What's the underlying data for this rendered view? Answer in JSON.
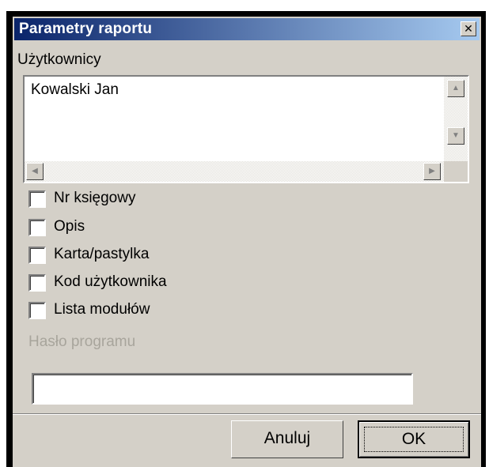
{
  "window": {
    "title": "Parametry raportu",
    "close_glyph": "✕"
  },
  "users": {
    "label": "Użytkownicy",
    "items": [
      "Kowalski  Jan"
    ]
  },
  "options": [
    {
      "label": "Nr księgowy",
      "checked": false
    },
    {
      "label": "Opis",
      "checked": false
    },
    {
      "label": "Karta/pastylka",
      "checked": false
    },
    {
      "label": "Kod użytkownika",
      "checked": false
    },
    {
      "label": "Lista modułów",
      "checked": false
    }
  ],
  "password": {
    "label": "Hasło programu",
    "value": ""
  },
  "buttons": {
    "cancel": "Anuluj",
    "ok": "OK"
  },
  "scroll_icons": {
    "up": "▲",
    "down": "▼",
    "left": "◀",
    "right": "▶"
  }
}
